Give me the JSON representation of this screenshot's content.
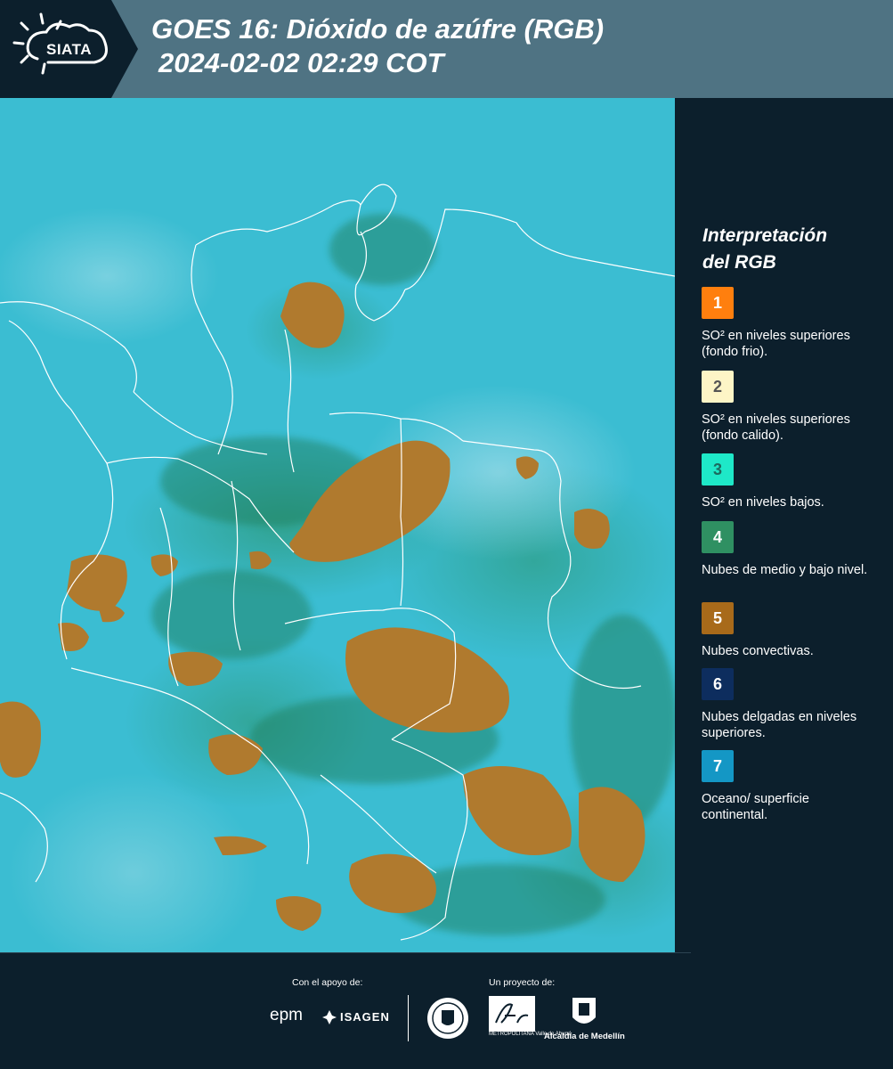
{
  "header": {
    "logo_text": "SIATA",
    "title_line1": "GOES 16: Dióxido de azúfre (RGB)",
    "title_line2": "2024-02-02 02:29 COT",
    "header_color": "#4f7383",
    "background_color": "#0c1f2c"
  },
  "legend": {
    "title_line1": "Interpretación",
    "title_line2": "del RGB",
    "items": [
      {
        "number": "1",
        "label": "SO² en niveles superiores (fondo frio).",
        "color": "#ff7f0e",
        "text_color": "#ffffff"
      },
      {
        "number": "2",
        "label": "SO² en niveles superiores (fondo calido).",
        "color": "#fdf5c6",
        "text_color": "#555555"
      },
      {
        "number": "3",
        "label": "SO² en niveles bajos.",
        "color": "#1ee8c8",
        "text_color": "#1c6a5e"
      },
      {
        "number": "4",
        "label": "Nubes de medio y bajo nivel.",
        "color": "#2f9062",
        "text_color": "#ffffff"
      },
      {
        "number": "5",
        "label": "Nubes convectivas.",
        "color": "#a86a1a",
        "text_color": "#ffffff"
      },
      {
        "number": "6",
        "label": "Nubes delgadas en niveles superiores.",
        "color": "#0d2d5e",
        "text_color": "#ffffff"
      },
      {
        "number": "7",
        "label": "Oceano/ superficie continental.",
        "color": "#1497c5",
        "text_color": "#ffffff"
      }
    ]
  },
  "map": {
    "ocean_land_color": "#3bbdd2",
    "convective_cloud_color": "#b07a2e",
    "border_color": "#ffffff"
  },
  "footer": {
    "support_label": "Con el apoyo de:",
    "project_label": "Un proyecto de:",
    "epm_text": "epm",
    "isagen_text": "ISAGEN",
    "area_text": "METROPOLITANA Valle de Aburrá",
    "alcaldia_text": "Alcaldía de Medellín"
  }
}
